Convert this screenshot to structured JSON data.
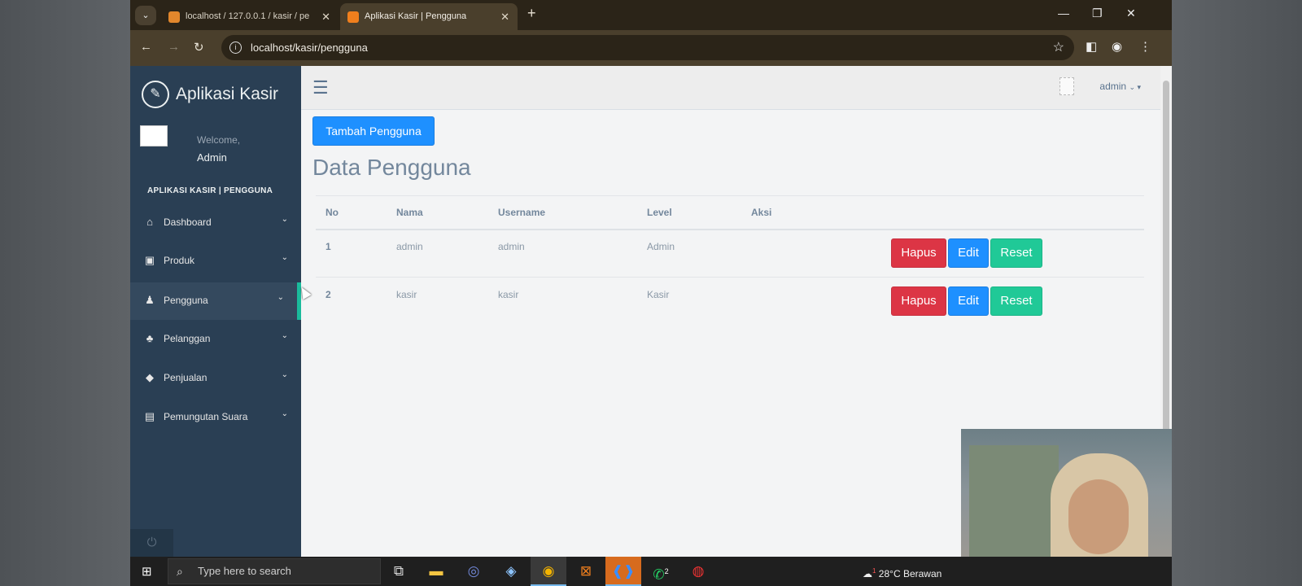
{
  "browser": {
    "tabs": [
      {
        "label": "localhost / 127.0.0.1 / kasir / pe",
        "active": false,
        "favicon": "phpmyadmin-icon"
      },
      {
        "label": "Aplikasi Kasir | Pengguna",
        "active": true,
        "favicon": "xampp-icon"
      }
    ],
    "url": "localhost/kasir/pengguna"
  },
  "sidebar": {
    "brand": "Aplikasi Kasir",
    "welcome": "Welcome,",
    "user_name": "Admin",
    "section_title": "APLIKASI KASIR | PENGGUNA",
    "items": [
      {
        "label": "Dashboard",
        "icon": "home-icon"
      },
      {
        "label": "Produk",
        "icon": "briefcase-icon"
      },
      {
        "label": "Pengguna",
        "icon": "user-icon"
      },
      {
        "label": "Pelanggan",
        "icon": "users-icon"
      },
      {
        "label": "Penjualan",
        "icon": "tag-icon"
      },
      {
        "label": "Pemungutan Suara",
        "icon": "archive-icon"
      }
    ],
    "active_item": "Pengguna"
  },
  "topnav": {
    "user_label": "admin"
  },
  "main": {
    "add_button": "Tambah Pengguna",
    "title": "Data Pengguna",
    "table": {
      "headers": [
        "No",
        "Nama",
        "Username",
        "Level",
        "Aksi"
      ],
      "rows": [
        {
          "no": "1",
          "nama": "admin",
          "username": "admin",
          "level": "Admin"
        },
        {
          "no": "2",
          "nama": "kasir",
          "username": "kasir",
          "level": "Kasir"
        }
      ],
      "actions": {
        "delete": "Hapus",
        "edit": "Edit",
        "reset": "Reset"
      }
    }
  },
  "taskbar": {
    "search_placeholder": "Type here to search",
    "weather_temp": "28°C",
    "weather_text": "Berawan",
    "whatsapp_badge": "2",
    "weather_badge": "1"
  },
  "colors": {
    "sidebar_bg": "#2a3f54",
    "active_accent": "#1abb9c",
    "primary": "#1e90ff",
    "danger": "#dc3545",
    "success": "#20c997"
  }
}
